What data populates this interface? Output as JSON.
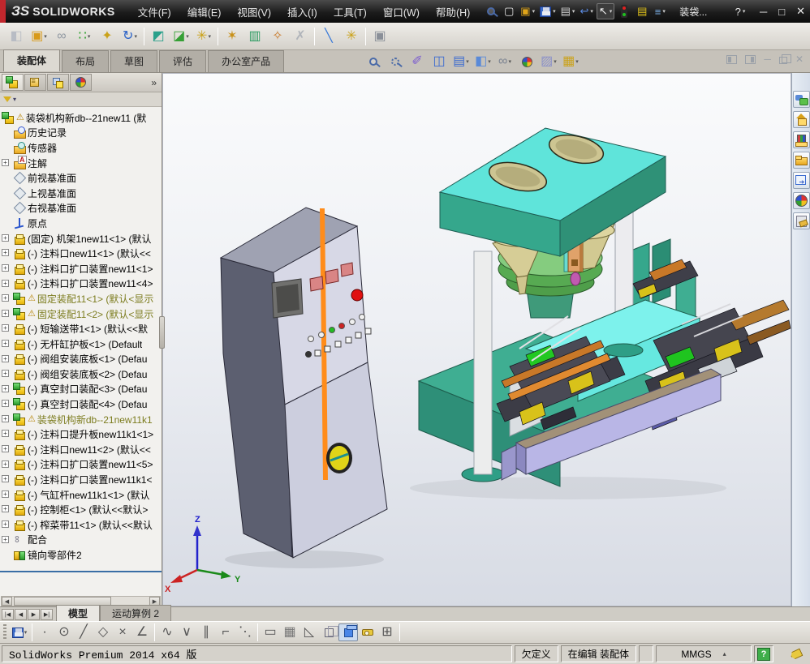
{
  "colors": {
    "titlebar_red": "#c1272d",
    "machine_teal": "#3aa88f",
    "machine_cyan": "#66ebe2",
    "cabinet_panel": "#d7d8e6",
    "stripe_orange": "#ff8c1a",
    "conveyor_lavender": "#b9b6e6",
    "warning_olive": "#7a7a1e",
    "rollback_blue": "#3a6ea5"
  },
  "title_bar": {
    "logo_prefix": "ЗS",
    "logo": "SOLIDWORKS",
    "doc_title": "装袋...",
    "menus": [
      {
        "label": "文件(F)",
        "name": "menu-file"
      },
      {
        "label": "编辑(E)",
        "name": "menu-edit"
      },
      {
        "label": "视图(V)",
        "name": "menu-view"
      },
      {
        "label": "插入(I)",
        "name": "menu-insert"
      },
      {
        "label": "工具(T)",
        "name": "menu-tools"
      },
      {
        "label": "窗口(W)",
        "name": "menu-window"
      },
      {
        "label": "帮助(H)",
        "name": "menu-help"
      }
    ],
    "quick_icons": [
      {
        "name": "search-icon",
        "icon": "mag"
      },
      {
        "name": "new-document-icon",
        "glyph": "▢",
        "color": "#e8e8e8"
      },
      {
        "name": "open-icon",
        "glyph": "▣",
        "color": "#e0a51a",
        "dd": true
      },
      {
        "name": "save-icon",
        "icon": "floppy",
        "dd": true
      },
      {
        "name": "print-icon",
        "glyph": "▤",
        "color": "#d8d8d8",
        "dd": true
      },
      {
        "name": "undo-icon",
        "glyph": "↩",
        "color": "#5a8ae0",
        "dd": true
      },
      {
        "name": "select-cursor-icon",
        "glyph": "↖",
        "color": "#f0f0f0",
        "pressed": true,
        "dd": true
      },
      {
        "name": "traffic-light-icon",
        "icon": "traffic"
      },
      {
        "name": "properties-icon",
        "glyph": "▤",
        "color": "#e0c21a"
      },
      {
        "name": "options-list-icon",
        "glyph": "≡",
        "color": "#7ab0e8",
        "dd": true
      }
    ],
    "help_glyph": "?",
    "window_buttons": {
      "minimize": "─",
      "maximize": "□",
      "close": "✕"
    }
  },
  "assembly_toolbar": [
    {
      "name": "edit-component-icon",
      "glyph": "◧",
      "color": "#b8bcc4"
    },
    {
      "name": "insert-components-icon",
      "glyph": "▣",
      "color": "#d89a1a",
      "dd": true
    },
    {
      "name": "mate-icon",
      "glyph": "∞",
      "color": "#9098a2"
    },
    {
      "name": "linear-component-pattern-icon",
      "glyph": "∷",
      "color": "#2aa02a",
      "dd": true
    },
    {
      "name": "smart-fasteners-icon",
      "glyph": "✦",
      "color": "#caa21a"
    },
    {
      "name": "rotate-component-icon",
      "glyph": "↻",
      "color": "#2a62c8",
      "dd": true
    },
    {
      "sep": true
    },
    {
      "name": "move-component-icon",
      "glyph": "◩",
      "color": "#2aa08a"
    },
    {
      "name": "show-hidden-components-icon",
      "glyph": "◪",
      "color": "#35a035",
      "dd": true
    },
    {
      "name": "assembly-features-icon",
      "glyph": "✳",
      "color": "#caa21a",
      "dd": true
    },
    {
      "sep": true
    },
    {
      "name": "motion-study-icon",
      "glyph": "✶",
      "color": "#c89018"
    },
    {
      "name": "bill-of-materials-icon",
      "glyph": "▥",
      "color": "#2a9a60"
    },
    {
      "name": "exploded-view-icon",
      "glyph": "✧",
      "color": "#c87828"
    },
    {
      "name": "instant3d-icon",
      "glyph": "✗",
      "color": "#b0b4ba"
    },
    {
      "sep": true
    },
    {
      "name": "measure-diagonal-icon",
      "glyph": "╲",
      "color": "#3a7ad8"
    },
    {
      "name": "interference-detection-icon",
      "glyph": "✳",
      "color": "#caa21a"
    },
    {
      "sep": true
    },
    {
      "name": "window-preview-icon",
      "glyph": "▣",
      "color": "#8a8f98"
    }
  ],
  "command_tabs": [
    {
      "label": "装配体",
      "name": "tab-assembly",
      "active": true
    },
    {
      "label": "布局",
      "name": "tab-layout"
    },
    {
      "label": "草图",
      "name": "tab-sketch"
    },
    {
      "label": "评估",
      "name": "tab-evaluate"
    },
    {
      "label": "办公室产品",
      "name": "tab-office-products"
    }
  ],
  "headsup_toolbar": [
    {
      "name": "zoom-fit-icon",
      "icon": "mag"
    },
    {
      "name": "zoom-area-icon",
      "icon": "magarea"
    },
    {
      "name": "previous-view-icon",
      "glyph": "✐",
      "color": "#7a5ad0"
    },
    {
      "name": "section-view-icon",
      "glyph": "◫",
      "color": "#3a6ad0"
    },
    {
      "name": "view-orientation-icon",
      "glyph": "▤",
      "color": "#3a6ad0",
      "dd": true
    },
    {
      "name": "display-style-icon",
      "glyph": "◧",
      "color": "#5a8ad8",
      "dd": true
    },
    {
      "name": "hide-show-items-icon",
      "glyph": "∞",
      "color": "#7a8290",
      "dd": true
    },
    {
      "name": "edit-appearance-icon",
      "icon": "colorball"
    },
    {
      "name": "apply-scene-icon",
      "glyph": "▨",
      "color": "#8a90c8",
      "dd": true
    },
    {
      "name": "view-settings-icon",
      "glyph": "▦",
      "color": "#caa21a",
      "dd": true
    }
  ],
  "left_panel": {
    "tabs": [
      {
        "name": "featuremanager-tab-icon",
        "icon": "asm",
        "active": true
      },
      {
        "name": "propertymanager-tab-icon",
        "icon": "propmgr"
      },
      {
        "name": "configurationmanager-tab-icon",
        "icon": "cfgmgr"
      },
      {
        "name": "displaymanager-tab-icon",
        "icon": "colorball"
      }
    ],
    "more_glyph": "»",
    "filter_arrow": "▾",
    "tree": [
      {
        "label": "装袋机构新db--21new11 (默",
        "icon": "asm",
        "warn": true,
        "root": true
      },
      {
        "label": "历史记录",
        "icon": "history"
      },
      {
        "label": "传感器",
        "icon": "sensors"
      },
      {
        "label": "注解",
        "icon": "ann",
        "exp": true
      },
      {
        "label": "前视基准面",
        "icon": "plane"
      },
      {
        "label": "上视基准面",
        "icon": "plane"
      },
      {
        "label": "右视基准面",
        "icon": "plane"
      },
      {
        "label": "原点",
        "icon": "origin"
      },
      {
        "label": "(固定) 机架1new11<1> (默认",
        "icon": "part",
        "exp": true
      },
      {
        "label": "(-) 注料口new11<1> (默认<<",
        "icon": "part",
        "exp": true
      },
      {
        "label": "(-) 注料口扩口装置new11<1>",
        "icon": "part",
        "exp": true
      },
      {
        "label": "(-) 注料口扩口装置new11<4>",
        "icon": "part",
        "exp": true
      },
      {
        "label": "固定装配11<1> (默认<显示",
        "icon": "asm",
        "warn": true,
        "muted": true,
        "exp": true
      },
      {
        "label": "固定装配11<2> (默认<显示",
        "icon": "asm",
        "warn": true,
        "muted": true,
        "exp": true
      },
      {
        "label": "(-) 短输送带1<1> (默认<<默",
        "icon": "part",
        "exp": true
      },
      {
        "label": "(-) 无杆缸护板<1> (Default",
        "icon": "part",
        "exp": true
      },
      {
        "label": "(-) 阀组安装底板<1> (Defau",
        "icon": "part",
        "exp": true
      },
      {
        "label": "(-) 阀组安装底板<2> (Defau",
        "icon": "part",
        "exp": true
      },
      {
        "label": "(-) 真空封口装配<3> (Defau",
        "icon": "asm",
        "exp": true
      },
      {
        "label": "(-) 真空封口装配<4> (Defau",
        "icon": "asm",
        "exp": true
      },
      {
        "label": "装袋机构新db--21new11k1",
        "icon": "asm",
        "warn": true,
        "muted": true,
        "exp": true
      },
      {
        "label": "(-) 注料口提升板new11k1<1>",
        "icon": "part",
        "exp": true
      },
      {
        "label": "(-) 注料口new11<2> (默认<<",
        "icon": "part",
        "exp": true
      },
      {
        "label": "(-) 注料口扩口装置new11<5>",
        "icon": "part",
        "exp": true
      },
      {
        "label": "(-) 注料口扩口装置new11k1<",
        "icon": "part",
        "exp": true
      },
      {
        "label": "(-) 气缸杆new11k1<1> (默认",
        "icon": "part",
        "exp": true
      },
      {
        "label": "(-) 控制柜<1> (默认<<默认>",
        "icon": "part",
        "exp": true
      },
      {
        "label": "(-) 榨菜带11<1> (默认<<默认",
        "icon": "part",
        "exp": true
      },
      {
        "label": "配合",
        "icon": "mates",
        "exp": true
      },
      {
        "label": "镜向零部件2",
        "icon": "mirror"
      }
    ]
  },
  "viewport": {
    "triad": {
      "x": "X",
      "y": "Y",
      "z": "Z"
    }
  },
  "task_pane": [
    {
      "name": "solidworks-forum-icon",
      "icon2": "tp-forum"
    },
    {
      "name": "solidworks-resources-icon",
      "icon2": "tp-home"
    },
    {
      "name": "design-library-icon",
      "icon2": "tp-lib"
    },
    {
      "name": "file-explorer-icon",
      "icon2": "tp-folder"
    },
    {
      "name": "view-palette-icon",
      "icon2": "tp-view"
    },
    {
      "name": "appearances-scenes-icon",
      "icon2": "ic-colorball"
    },
    {
      "name": "custom-properties-icon",
      "icon2": "tp-custom"
    }
  ],
  "bottom_tabs": {
    "nav": [
      "|◀",
      "◀",
      "▶",
      "▶|"
    ],
    "tabs": [
      {
        "label": "模型",
        "name": "tab-model",
        "active": true
      },
      {
        "label": "运动算例 2",
        "name": "tab-motion-study-2"
      }
    ]
  },
  "bottom_toolbar": [
    {
      "name": "save-icon",
      "icon": "floppy",
      "dd": true
    },
    {
      "sep": true
    },
    {
      "name": "point-tool-icon",
      "glyph": "·",
      "color": "#444"
    },
    {
      "name": "circle-tool-icon",
      "glyph": "⊙",
      "color": "#555"
    },
    {
      "name": "line-tool-icon",
      "glyph": "╱",
      "color": "#555"
    },
    {
      "name": "polygon-tool-icon",
      "glyph": "◇",
      "color": "#555"
    },
    {
      "name": "trim-tool-icon",
      "glyph": "×",
      "color": "#555"
    },
    {
      "name": "angle-tool-icon",
      "glyph": "∠",
      "color": "#555"
    },
    {
      "sep": true
    },
    {
      "name": "tangent-arc-icon",
      "glyph": "∿",
      "color": "#555"
    },
    {
      "name": "symmetry-relation-icon",
      "glyph": "∨",
      "color": "#555"
    },
    {
      "name": "parallel-relation-icon",
      "glyph": "∥",
      "color": "#555"
    },
    {
      "name": "perpendicular-relation-icon",
      "glyph": "⌐",
      "color": "#555"
    },
    {
      "name": "construction-line-icon",
      "glyph": "⋱",
      "color": "#555"
    },
    {
      "sep": true
    },
    {
      "name": "dimension-icon",
      "glyph": "▭",
      "color": "#555"
    },
    {
      "name": "grid-snap-icon",
      "glyph": "▦",
      "color": "#777"
    },
    {
      "name": "triangle-snap-icon",
      "glyph": "◺",
      "color": "#555"
    },
    {
      "name": "wireframe-display-icon",
      "icon": "cubewire"
    },
    {
      "name": "shaded-display-icon",
      "icon": "cubeshade",
      "pressed": true
    },
    {
      "name": "measure-icon",
      "icon": "measure"
    },
    {
      "name": "table-icon",
      "glyph": "⊞",
      "color": "#555"
    },
    {
      "sep": true
    }
  ],
  "status_bar": {
    "product": "SolidWorks Premium 2014 x64 版",
    "state": "欠定义",
    "editing": "在编辑  装配体",
    "units": "MMGS",
    "units_arrow": "▴",
    "help": "?"
  }
}
